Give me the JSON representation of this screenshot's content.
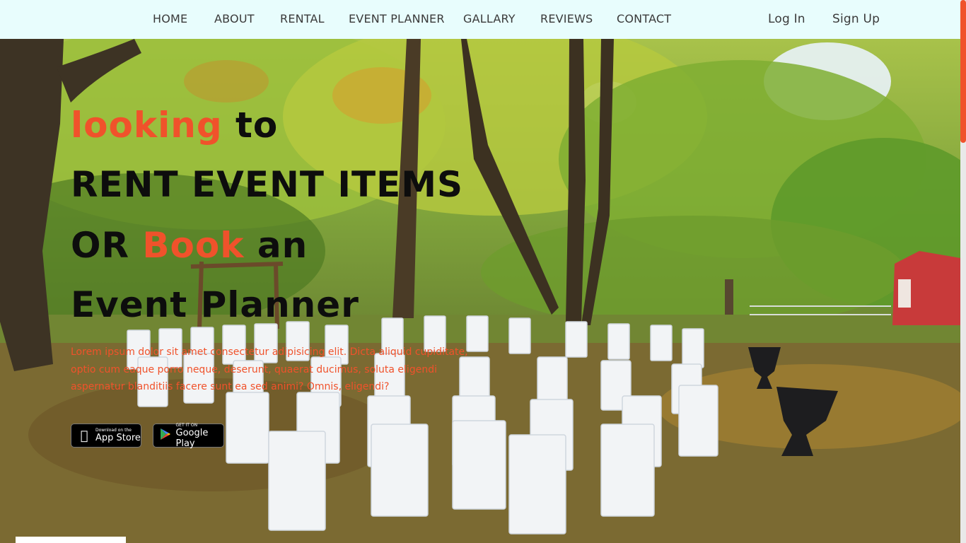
{
  "nav": {
    "links": [
      "HOME",
      "ABOUT",
      "RENTAL",
      "EVENT PLANNER",
      "GALLARY",
      "REVIEWS",
      "CONTACT"
    ],
    "login": "Log In",
    "signup": "Sign Up"
  },
  "hero": {
    "line1_accent": "looking",
    "line1_rest": " to",
    "line2": "RENT EVENT ITEMS",
    "line3_start": "OR ",
    "line3_accent": "Book",
    "line3_end": " an",
    "line4": "Event Planner",
    "lorem": "Lorem ipsum dolor sit amet consectetur adipisicing elit. Dicta aliquid cupiditate, optio cum eaque porro neque, deserunt, quaerat ducimus, soluta eligendi aspernatur blanditiis facere sunt ea sed animi? Omnis, eligendi?",
    "appstore": {
      "small": "Download on the",
      "big": "App Store"
    },
    "googleplay": {
      "small": "GET IT ON",
      "big": "Google Play"
    }
  },
  "colors": {
    "accent": "#f0522b",
    "nav_bg": "#e8fdfd"
  },
  "icons": {
    "apple": "apple-icon",
    "play": "google-play-icon"
  }
}
